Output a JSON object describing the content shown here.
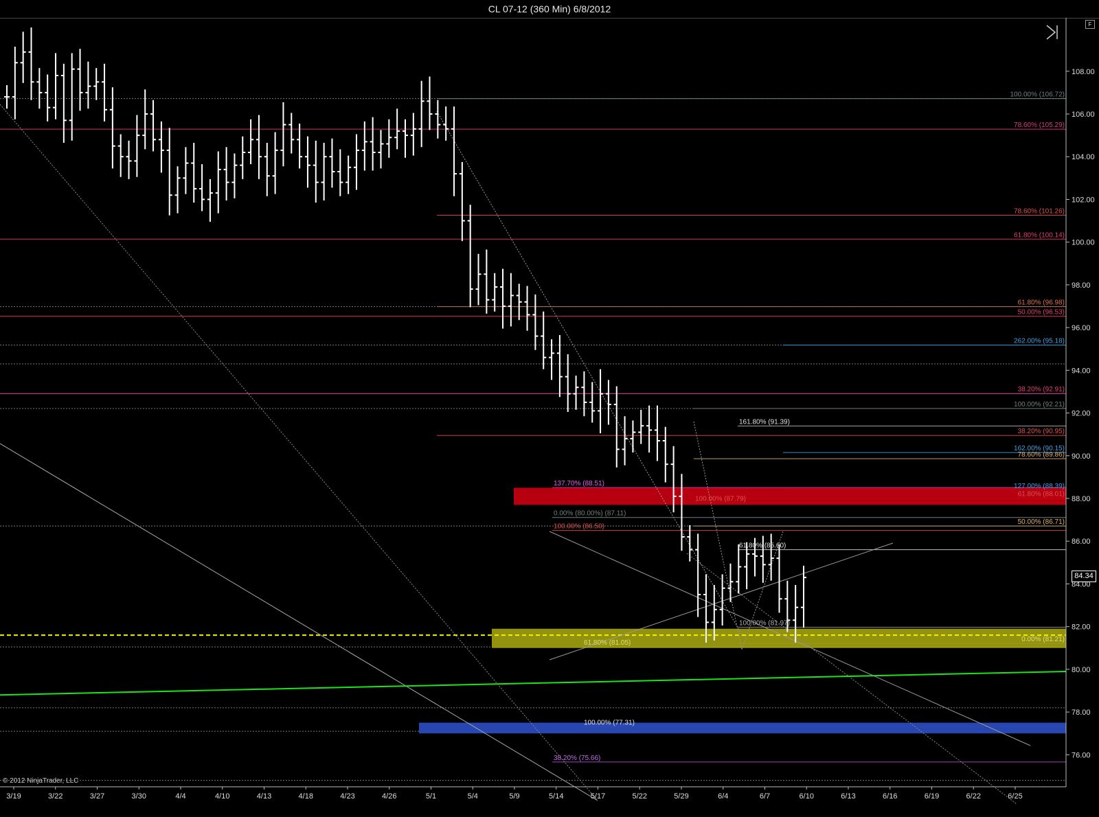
{
  "window": {
    "title": "CL 07-12 (360 Min)  6/8/2012",
    "f_button": "F",
    "copyright": "© 2012 NinjaTrader, LLC",
    "current_price_label": "84.34"
  },
  "colors": {
    "background": "#000000",
    "bars": "#ffffff",
    "red_zone": "#c00010",
    "yellow_zone": "#9a9a10",
    "blue_zone": "#2a4ab8",
    "green_trend": "#19e619"
  },
  "icons": [
    "scroll-to-end-icon"
  ],
  "chart_data": {
    "type": "ohlc",
    "symbol": "CL 07-12",
    "interval": "360 Min",
    "ylim": [
      74.5,
      110.5
    ],
    "y_ticks": [
      "108.00",
      "106.00",
      "104.00",
      "102.00",
      "100.00",
      "98.00",
      "96.00",
      "94.00",
      "92.00",
      "90.00",
      "88.00",
      "86.00",
      "84.00",
      "82.00",
      "80.00",
      "78.00",
      "76.00"
    ],
    "x_ticks": [
      "3/19",
      "3/22",
      "3/27",
      "3/30",
      "4/4",
      "4/10",
      "4/13",
      "4/18",
      "4/23",
      "4/26",
      "5/1",
      "5/4",
      "5/9",
      "5/14",
      "5/17",
      "5/22",
      "5/29",
      "6/4",
      "6/7",
      "6/10",
      "6/13",
      "6/16",
      "6/19",
      "6/22",
      "6/25"
    ],
    "last_price": 84.34,
    "closes_approx": [
      106.8,
      108.4,
      108.9,
      107.5,
      107.0,
      106.3,
      107.8,
      105.7,
      108.1,
      107.0,
      107.3,
      107.5,
      106.2,
      104.5,
      104.0,
      103.8,
      105.0,
      106.0,
      104.8,
      104.3,
      102.2,
      103.0,
      103.7,
      102.5,
      102.0,
      102.3,
      103.4,
      102.8,
      103.6,
      104.2,
      104.8,
      104.0,
      103.1,
      104.3,
      105.5,
      104.8,
      104.0,
      103.6,
      102.8,
      104.0,
      103.3,
      102.8,
      103.5,
      104.3,
      104.7,
      104.2,
      104.6,
      104.9,
      105.2,
      105.0,
      105.3,
      106.6,
      106.0,
      105.5,
      105.3,
      103.2,
      101.0,
      97.8,
      98.5,
      97.3,
      97.9,
      97.0,
      97.5,
      97.2,
      96.6,
      95.6,
      94.6,
      94.8,
      93.7,
      92.9,
      93.2,
      92.5,
      92.1,
      92.9,
      92.4,
      90.3,
      90.8,
      91.1,
      91.4,
      91.2,
      90.7,
      89.6,
      88.1,
      86.2,
      85.6,
      83.5,
      82.2,
      82.8,
      83.8,
      84.1,
      84.8,
      85.4,
      85.3,
      84.9,
      85.2,
      83.3,
      82.3,
      82.9,
      84.3
    ],
    "horizontal_levels": [
      {
        "label": "100.00% (106.72)",
        "value": 106.72
      },
      {
        "label": "78.60% (105.29)",
        "value": 105.29
      },
      {
        "label": "78.60% (101.26)",
        "value": 101.26
      },
      {
        "label": "61.80% (100.14)",
        "value": 100.14
      },
      {
        "label": "61.80% (96.98)",
        "value": 96.98
      },
      {
        "label": "50.00% (96.53)",
        "value": 96.53
      },
      {
        "label": "262.00% (95.18)",
        "value": 95.18
      },
      {
        "label": "38.20% (92.91)",
        "value": 92.91
      },
      {
        "label": "100.00% (92.21)",
        "value": 92.21
      },
      {
        "label": "161.80% (91.39)",
        "value": 91.39
      },
      {
        "label": "38.20% (90.95)",
        "value": 90.95
      },
      {
        "label": "162.00% (90.15)",
        "value": 90.15
      },
      {
        "label": "78.60% (89.86)",
        "value": 89.86
      },
      {
        "label": "137.70% (88.51)",
        "value": 88.51
      },
      {
        "label": "127.00% (88.39)",
        "value": 88.39
      },
      {
        "label": "61.80% (88.01)",
        "value": 88.01
      },
      {
        "label": "100.00% (87.79)",
        "value": 87.79
      },
      {
        "label": "0.00% (80.00%) (87.11)",
        "value": 87.11
      },
      {
        "label": "50.00% (86.71)",
        "value": 86.71
      },
      {
        "label": "100.00% (86.50)",
        "value": 86.5
      },
      {
        "label": "61.80% (85.60)",
        "value": 85.6
      },
      {
        "label": "100.00% (81.97)",
        "value": 81.97
      },
      {
        "label": "0.00% (81.21)",
        "value": 81.21
      },
      {
        "label": "61.80% (81.05)",
        "value": 81.05
      },
      {
        "label": "100.00% (77.31)",
        "value": 77.31
      },
      {
        "label": "38.20% (75.66)",
        "value": 75.66
      }
    ],
    "zones": [
      {
        "name": "red-resistance-zone",
        "from": 87.7,
        "to": 88.5
      },
      {
        "name": "yellow-support-zone",
        "from": 81.0,
        "to": 81.9
      },
      {
        "name": "blue-target-zone",
        "from": 77.0,
        "to": 77.5
      }
    ],
    "dashed_support": 81.6
  }
}
